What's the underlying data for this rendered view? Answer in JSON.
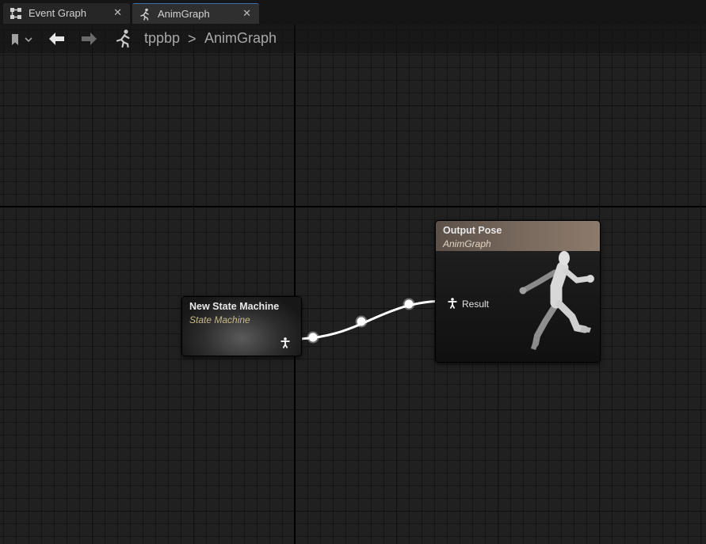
{
  "tabs": [
    {
      "label": "Event Graph",
      "icon": "event-graph-icon",
      "active": false
    },
    {
      "label": "AnimGraph",
      "icon": "anim-graph-icon",
      "active": true
    }
  ],
  "breadcrumb": {
    "items": [
      "tppbp",
      "AnimGraph"
    ],
    "separator": ">"
  },
  "nodes": {
    "state_machine": {
      "title": "New State Machine",
      "subtitle": "State Machine"
    },
    "output_pose": {
      "title": "Output Pose",
      "subtitle": "AnimGraph",
      "result_label": "Result"
    }
  },
  "tab_close_glyph": "✕",
  "colors": {
    "accent": "#3a6fb0",
    "output_header": "#7a6a5e",
    "wire": "#ffffff",
    "grid_bg": "#202020"
  }
}
